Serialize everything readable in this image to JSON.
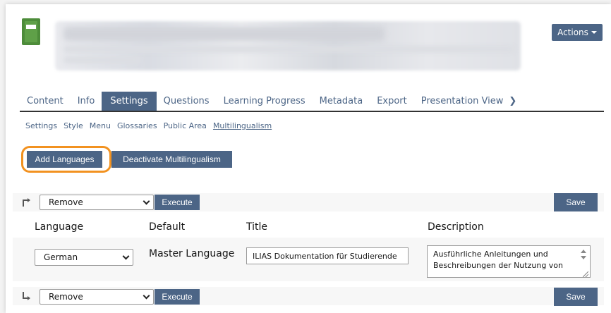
{
  "header": {
    "actions_label": "Actions"
  },
  "tabs": [
    {
      "label": "Content"
    },
    {
      "label": "Info"
    },
    {
      "label": "Settings",
      "active": true
    },
    {
      "label": "Questions"
    },
    {
      "label": "Learning Progress"
    },
    {
      "label": "Metadata"
    },
    {
      "label": "Export"
    },
    {
      "label": "Presentation View"
    }
  ],
  "subtabs": [
    {
      "label": "Settings"
    },
    {
      "label": "Style"
    },
    {
      "label": "Menu"
    },
    {
      "label": "Glossaries"
    },
    {
      "label": "Public Area"
    },
    {
      "label": "Multilingualism",
      "active": true
    }
  ],
  "buttons": {
    "add_languages": "Add Languages",
    "deactivate": "Deactivate Multilingualism",
    "execute": "Execute",
    "save": "Save"
  },
  "bulk_action": {
    "selected": "Remove"
  },
  "table": {
    "columns": [
      "Language",
      "Default",
      "Title",
      "Description"
    ],
    "rows": [
      {
        "language": "German",
        "default": "Master Language",
        "title": "ILIAS Dokumentation für Studierende",
        "description_line1": "Ausführliche Anleitungen und",
        "description_line2": "Beschreibungen der Nutzung von"
      }
    ]
  },
  "colors": {
    "primary": "#4c6586",
    "highlight": "#f29220",
    "book_icon": "#4d8c3a"
  },
  "icons": [
    "book-icon",
    "caret-down-icon",
    "chevron-right-icon",
    "arrow-up-right-icon",
    "arrow-down-right-icon",
    "chevron-down-icon"
  ]
}
